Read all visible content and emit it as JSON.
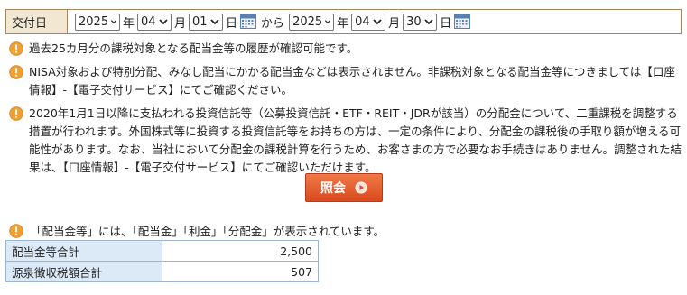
{
  "date_filter": {
    "label": "交付日",
    "start": {
      "year": "2025",
      "year_unit": "年",
      "month": "04",
      "month_unit": "月",
      "day": "01",
      "day_unit": "日"
    },
    "separator": "から",
    "end": {
      "year": "2025",
      "year_unit": "年",
      "month": "04",
      "month_unit": "月",
      "day": "30",
      "day_unit": "日"
    }
  },
  "notes": [
    "過去25カ月分の課税対象となる配当金等の履歴が確認可能です。",
    "NISA対象および特別分配、みなし配当にかかる配当金などは表示されません。非課税対象となる配当金等につきましては【口座情報】-【電子交付サービス】にてご確認ください。",
    "2020年1月1日以降に支払われる投資信託等（公募投資信託・ETF・REIT・JDRが該当）の分配金について、二重課税を調整する措置が行われます。外国株式等に投資する投資信託等をお持ちの方は、一定の条件により、分配金の課税後の手取り額が増える可能性があります。なお、当社において分配金の課税計算を行うため、お客さまの方で必要なお手続きはありません。調整された結果は、【口座情報】-【電子交付サービス】にてご確認いただけます。"
  ],
  "inquiry_button": "照会",
  "summary_note": "「配当金等」には、「配当金」「利金」「分配金」が表示されています。",
  "summary": [
    {
      "label": "配当金等合計",
      "value": "2,500"
    },
    {
      "label": "源泉徴収税額合計",
      "value": "507"
    }
  ],
  "colors": {
    "accent": "#e8582a",
    "warning_icon": "#f0a030",
    "label_bg": "#f2e7d2",
    "table_label_bg": "#dce9f6"
  },
  "icons": {
    "warning": "exclamation-circle-icon",
    "calendar": "calendar-icon",
    "dropdown": "chevron-down-icon",
    "button_arrow": "play-circle-icon"
  }
}
